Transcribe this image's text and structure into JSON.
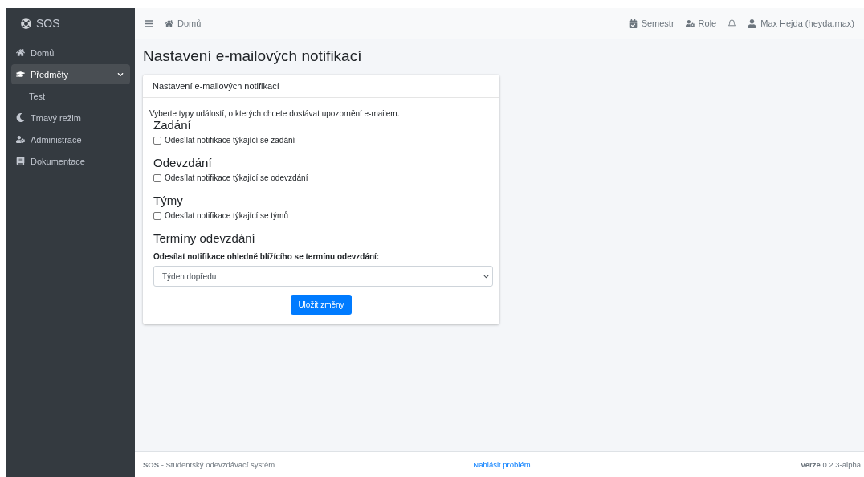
{
  "brand": "SOS",
  "sidebar": {
    "items": [
      {
        "label": "Domů",
        "selected": false
      },
      {
        "label": "Předměty",
        "selected": true,
        "expanded": true,
        "children": [
          {
            "label": "Test",
            "selected": false
          }
        ]
      },
      {
        "label": "Tmavý režim",
        "selected": false
      },
      {
        "label": "Administrace",
        "selected": false
      },
      {
        "label": "Dokumentace",
        "selected": false
      }
    ]
  },
  "topbar": {
    "breadcrumb": "Domů",
    "items": [
      {
        "label": "Semestr"
      },
      {
        "label": "Role"
      },
      {
        "label": "Max Hejda (heyda.max)"
      }
    ]
  },
  "page_title": "Nastavení e-mailových notifikací",
  "card": {
    "header": "Nastavení e-mailových notifikací",
    "intro": "Vyberte typy událostí, o kterých chcete dostávat upozornění e-mailem.",
    "sections": [
      {
        "heading": "Zadání",
        "kind": "checkbox",
        "label": "Odesílat notifikace týkající se zadání",
        "checked": false
      },
      {
        "heading": "Odevzdání",
        "kind": "checkbox",
        "label": "Odesílat notifikace týkající se odevzdání",
        "checked": false
      },
      {
        "heading": "Týmy",
        "kind": "checkbox",
        "label": "Odesílat notifikace týkající se týmů",
        "checked": false
      },
      {
        "heading": "Termíny odevzdání",
        "kind": "select",
        "label": "Odesílat notifikace ohledně blížícího se termínu odevzdání:",
        "value": "Týden dopředu"
      }
    ],
    "button": "Uložit změny"
  },
  "footer": {
    "left": "**SOS** - Studentský odevzdávací systém",
    "link": "Nahlásit problém",
    "right": "**Verze** 0.2.3-alpha"
  }
}
